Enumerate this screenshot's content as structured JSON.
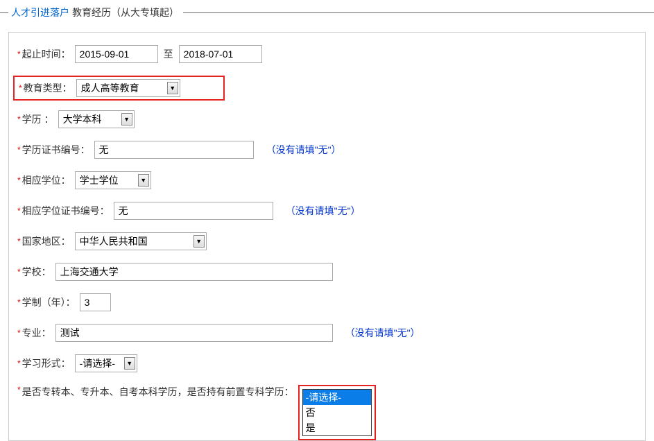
{
  "header": {
    "title1": "人才引进落户",
    "title2": "教育经历（从大专填起）"
  },
  "labels": {
    "period": "起止时间：",
    "to": "至",
    "eduType": "教育类型：",
    "degree": "学历 ：",
    "degreeCertNo": "学历证书编号：",
    "relDegree": "相应学位：",
    "relDegreeCertNo": "相应学位证书编号：",
    "countryRegion": "国家地区：",
    "school": "学校：",
    "years": "学制（年）：",
    "major": "专业：",
    "studyMode": "学习形式：",
    "specialQuestion": "是否专转本、专升本、自考本科学历，是否持有前置专科学历："
  },
  "values": {
    "startDate": "2015-09-01",
    "endDate": "2018-07-01",
    "eduType": "成人高等教育",
    "degree": "大学本科",
    "degreeCertNo": "无",
    "relDegree": "学士学位",
    "relDegreeCertNo": "无",
    "countryRegion": "中华人民共和国",
    "school": "上海交通大学",
    "years": "3",
    "major": "测试",
    "studyMode": "-请选择-"
  },
  "hints": {
    "noneHint": "（没有请填\"无\"）"
  },
  "dropdown": {
    "options": [
      "-请选择-",
      "否",
      "是"
    ]
  }
}
